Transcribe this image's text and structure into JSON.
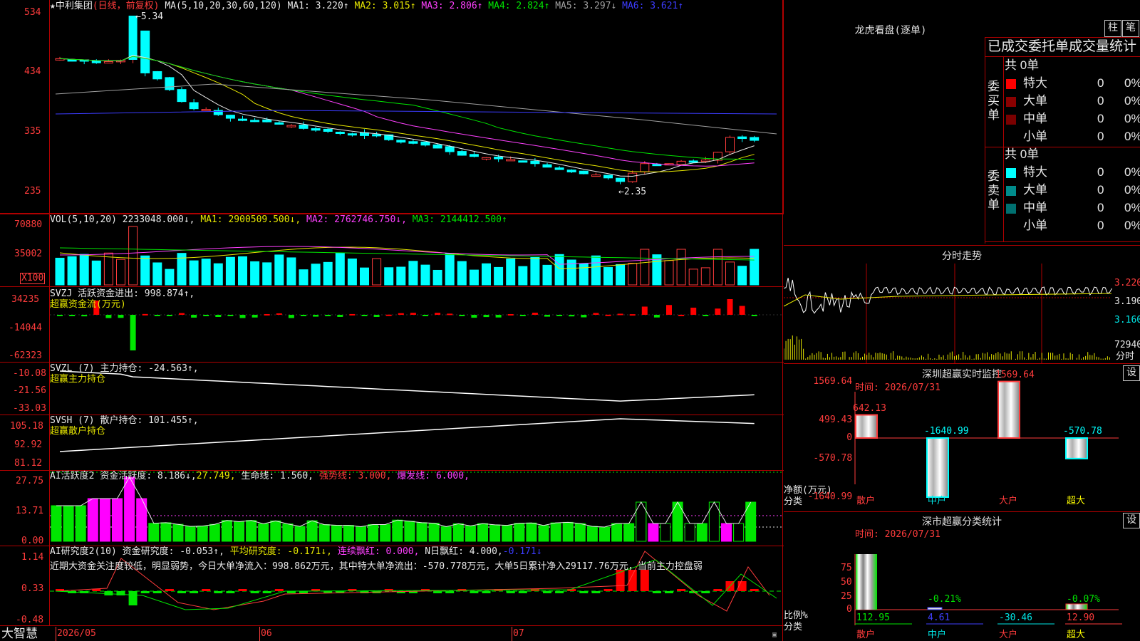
{
  "app_logo": "大智慧",
  "main": {
    "star": "★",
    "stock_name": "中利集团",
    "period": "(日线，前复权)",
    "ma_title": "MA(5,10,20,30,60,120)",
    "ma1": "MA1: 3.220↑",
    "ma2": "MA2: 3.015↑",
    "ma3": "MA3: 2.806↑",
    "ma4": "MA4: 2.824↑",
    "ma5": "MA5: 3.297↓",
    "ma6": "MA6: 3.621↑",
    "high_mark": "5.34",
    "low_mark": "2.35",
    "yaxis": [
      "534",
      "434",
      "335",
      "235"
    ]
  },
  "vol": {
    "title": "VOL(5,10,20)",
    "val": "2233048.000↓,",
    "ma1": "MA1: 2900509.500↓,",
    "ma2": "MA2: 2762746.750↓,",
    "ma3": "MA3: 2144412.500↑",
    "yaxis": [
      "70880",
      "35002"
    ],
    "unit": "X100"
  },
  "svzj": {
    "title": "SVZJ",
    "line": "活跃资金进出: 998.874↑,",
    "sub": "超赢资金流(万元)",
    "yaxis": [
      "34235",
      "-14044",
      "-62323"
    ]
  },
  "svzl": {
    "title": "SVZL (7)",
    "line": "主力持仓: -24.563↑,",
    "sub": "超赢主力持仓",
    "yaxis": [
      "-10.08",
      "-21.56",
      "-33.03"
    ]
  },
  "svsh": {
    "title": "SVSH (7)",
    "line": "散户持仓: 101.455↑,",
    "sub": "超赢散户持仓",
    "yaxis": [
      "105.18",
      "92.92",
      "81.12"
    ]
  },
  "ai1": {
    "title": "AI活跃度2",
    "l1": "资金活跃度: 8.186↓,",
    "l2": "27.749,",
    "l3": "生命线: 1.560,",
    "l4": "强势线: 3.000,",
    "l5": "爆发线: 6.000,",
    "yaxis": [
      "27.75",
      "13.71",
      "0.00"
    ]
  },
  "ai2": {
    "title": "AI研究度2(10)",
    "l1": "资金研究度: -0.053↑,",
    "l2": "平均研究度: -0.171↓,",
    "l3": "连续飘红: 0.000,",
    "l4": "N日飘红: 4.000,",
    "l5": "-0.171↓",
    "desc": "近期大资金关注度较低，明显弱势，今日大单净流入：998.862万元，其中特大单净流出：-570.778万元，大单5日累计净入29117.76万元，当前主力控盘弱",
    "yaxis": [
      "1.14",
      "0.33",
      "-0.48"
    ]
  },
  "dates": [
    "2026/05",
    "06",
    "07"
  ],
  "lhb": {
    "title": "龙虎看盘(逐单)",
    "btn1": "柱",
    "btn2": "笔",
    "tab": "已成交委托单成交量统计",
    "buy_total": "共 0单",
    "sell_total": "共 0单",
    "buy_label": "委买单",
    "sell_label": "委卖单",
    "rows": [
      {
        "name": "特大",
        "count": "0",
        "pct": "0%"
      },
      {
        "name": "大单",
        "count": "0",
        "pct": "0%"
      },
      {
        "name": "中单",
        "count": "0",
        "pct": "0%"
      },
      {
        "name": "小单",
        "count": "0",
        "pct": "0%"
      }
    ],
    "colors": {
      "buy_xl": "#ff0000",
      "buy_l": "#8b0000",
      "buy_m": "#7a0000",
      "sell_xl": "#00ffff",
      "sell_l": "#008b8b",
      "sell_m": "#007070"
    }
  },
  "fenshi": {
    "title": "分时走势",
    "yaxis": [
      "3.220",
      "3.190",
      "3.160"
    ],
    "vol": "72940",
    "vol_unit": "分时"
  },
  "sz_monitor": {
    "title": "深圳超赢实时监控",
    "btn": "设",
    "time": "时间: 2026/07/31",
    "yaxis": [
      "1569.64",
      "499.43",
      "0",
      "-570.78",
      "-1640.99"
    ],
    "ylabel1": "净额(万元)",
    "ylabel2": "分类",
    "categories": [
      "散户",
      "中户",
      "大户",
      "超大"
    ],
    "values": [
      642.13,
      -1640.99,
      1569.64,
      -570.78
    ],
    "value_labels": [
      "642.13",
      "-1640.99",
      "1569.64",
      "-570.78"
    ]
  },
  "sz_class": {
    "title": "深市超赢分类统计",
    "btn": "设",
    "time": "时间: 2026/07/31",
    "yaxis": [
      "75",
      "50",
      "25",
      "0"
    ],
    "ylabel1": "比例%",
    "ylabel2": "分类",
    "categories": [
      "散户",
      "中户",
      "大户",
      "超大"
    ],
    "bottom_values": [
      "112.95",
      "4.61",
      "-30.46",
      "12.90"
    ],
    "top_labels": [
      "",
      "-0.21%",
      "",
      "-0.07%"
    ]
  }
}
